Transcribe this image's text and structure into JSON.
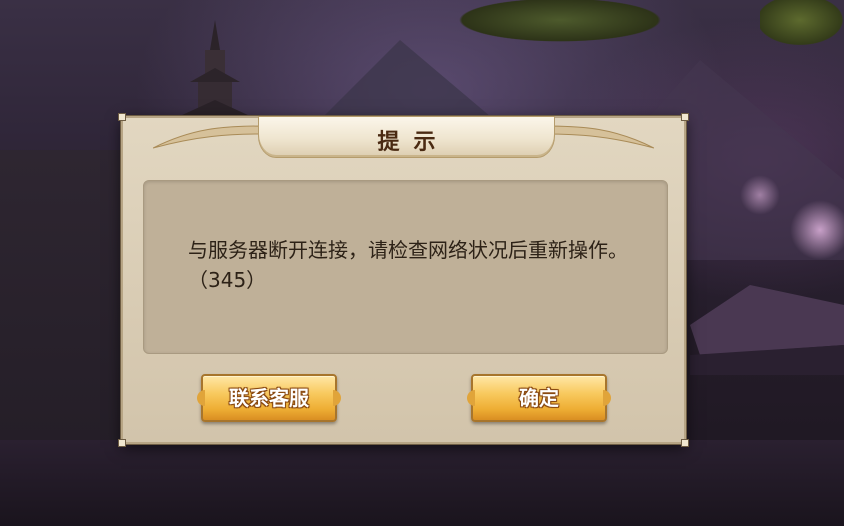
{
  "dialog": {
    "title": "提示",
    "message": "与服务器断开连接，请检查网络状况后重新操作。（345）",
    "buttons": {
      "contact_support": "联系客服",
      "confirm": "确定"
    }
  },
  "colors": {
    "panel": "#e2d7c1",
    "content_box": "#bfb098",
    "title_text": "#4a2a12",
    "button_gold": "#f8c95e"
  }
}
